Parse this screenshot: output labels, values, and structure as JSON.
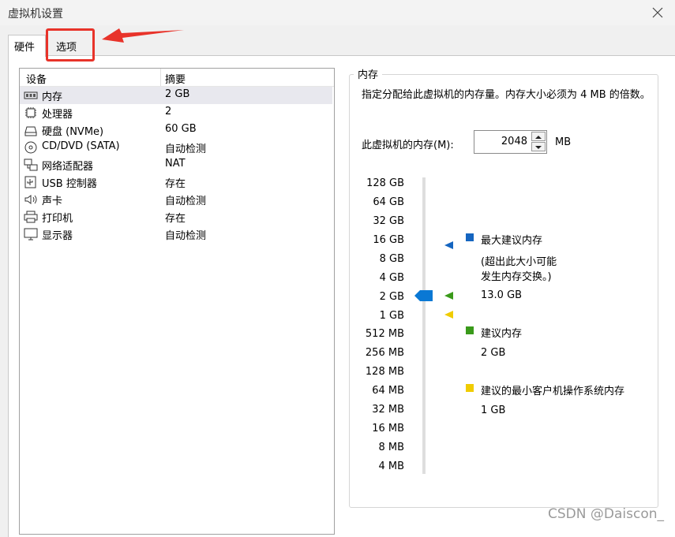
{
  "window": {
    "title": "虚拟机设置"
  },
  "tabs": {
    "hardware": "硬件",
    "options": "选项"
  },
  "device_table": {
    "col_device": "设备",
    "col_summary": "摘要",
    "rows": [
      {
        "icon": "memory-icon",
        "name": "内存",
        "summary": "2 GB"
      },
      {
        "icon": "processor-icon",
        "name": "处理器",
        "summary": "2"
      },
      {
        "icon": "hard-disk-icon",
        "name": "硬盘 (NVMe)",
        "summary": "60 GB"
      },
      {
        "icon": "cd-dvd-icon",
        "name": "CD/DVD (SATA)",
        "summary": "自动检测"
      },
      {
        "icon": "network-adapter-icon",
        "name": "网络适配器",
        "summary": "NAT"
      },
      {
        "icon": "usb-controller-icon",
        "name": "USB 控制器",
        "summary": "存在"
      },
      {
        "icon": "sound-card-icon",
        "name": "声卡",
        "summary": "自动检测"
      },
      {
        "icon": "printer-icon",
        "name": "打印机",
        "summary": "存在"
      },
      {
        "icon": "display-icon",
        "name": "显示器",
        "summary": "自动检测"
      }
    ]
  },
  "memory": {
    "group_title": "内存",
    "description": "指定分配给此虚拟机的内存量。内存大小必须为 4 MB 的倍数。",
    "field_label": "此虚拟机的内存(M):",
    "value": "2048",
    "unit": "MB",
    "scale_ticks": [
      "128 GB",
      "64 GB",
      "32 GB",
      "16 GB",
      "8 GB",
      "4 GB",
      "2 GB",
      "1 GB",
      "512 MB",
      "256 MB",
      "128 MB",
      "64 MB",
      "32 MB",
      "16 MB",
      "8 MB",
      "4 MB"
    ],
    "current_level": "2 GB",
    "legend": {
      "max_recommended": {
        "title": "最大建议内存",
        "note_line1": "(超出此大小可能",
        "note_line2": "发生内存交换。)",
        "value": "13.0 GB",
        "color": "#1565c0",
        "level": "16 GB"
      },
      "recommended": {
        "title": "建议内存",
        "value": "2 GB",
        "color": "#3a9a1a",
        "level": "2 GB"
      },
      "guest_min": {
        "title": "建议的最小客户机操作系统内存",
        "value": "1 GB",
        "color": "#f0cc00",
        "level": "1 GB"
      }
    },
    "thumb_color": "#0a78d4"
  },
  "watermark": "CSDN @Daiscon_"
}
